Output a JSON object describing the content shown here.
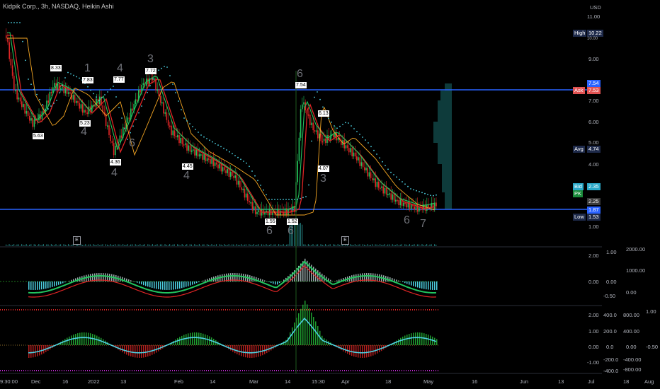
{
  "header": {
    "title": "Kidpik Corp., 3h, NASDAQ, Heikin Ashi"
  },
  "price_axis": {
    "currency": "USD",
    "labels": [
      "11.00",
      "9.00",
      "8.00",
      "7.00",
      "6.00",
      "5.00",
      "4.00",
      "3.00",
      "2.00",
      "1.00"
    ],
    "partial_label": "10.00",
    "high": {
      "label": "High",
      "value": "10.22"
    },
    "ask": {
      "label": "Ask",
      "value": "7.53"
    },
    "level_upper": "7.54",
    "avg": {
      "label": "Avg",
      "value": "4.74"
    },
    "bid": {
      "label": "Bid",
      "value": "2.35"
    },
    "pk": {
      "label": "PK"
    },
    "last": "2.25",
    "level_lower": "1.87",
    "low": {
      "label": "Low",
      "value": "1.53"
    }
  },
  "pane2_axis": {
    "left": [
      "1.00",
      "0.00",
      "-0.50"
    ],
    "right": [
      "2000.00",
      "1000.00",
      "0.00"
    ],
    "mid": [
      "2.00",
      "0.00"
    ]
  },
  "pane3_axis": {
    "col1": [
      "2.00",
      "1.00",
      "0.00",
      "-1.00"
    ],
    "col2": [
      "400.0",
      "200.0",
      "0.0",
      "-200.0",
      "-400.0"
    ],
    "col3": [
      "800.00",
      "400.00",
      "0.00",
      "-400.00",
      "-800.00"
    ],
    "col4": [
      "1.00",
      "-0.50"
    ]
  },
  "time_axis": {
    "labels": [
      "9:30:00",
      "Dec",
      "16",
      "2022",
      "13",
      "Feb",
      "14",
      "Mar",
      "14",
      "15:30",
      "Apr",
      "18",
      "May",
      "16",
      "Jun",
      "13",
      "Jul",
      "18",
      "Aug"
    ]
  },
  "price_labels": [
    "8.33",
    "7.83",
    "7.77",
    "7.72",
    "5.63",
    "5.23",
    "4.36",
    "4.45",
    "7.54",
    "6.13",
    "4.07",
    "1.55",
    "1.52"
  ],
  "wave_labels": [
    "1",
    "4",
    "3",
    "4",
    "4",
    "6",
    "4",
    "6",
    "6",
    "3",
    "6",
    "6",
    "7"
  ],
  "earnings_marker": "E",
  "colors": {
    "bull": "#22c55e",
    "bear": "#e02525",
    "accent_blue": "#2962ff",
    "cyan": "#4dd0e1",
    "orange": "#f5a623"
  }
}
